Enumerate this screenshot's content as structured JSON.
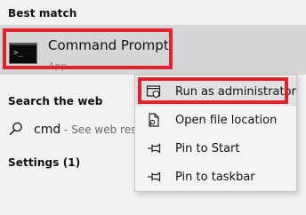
{
  "best_match": {
    "heading": "Best match",
    "app_name": "Command Prompt",
    "app_type": "App",
    "icon": "command-prompt-icon"
  },
  "search_web": {
    "heading": "Search the web",
    "query": "cmd",
    "suffix": " - See web resu",
    "icon": "search-icon"
  },
  "settings": {
    "heading": "Settings (1)"
  },
  "context_menu": {
    "items": [
      {
        "label": "Run as administrator",
        "icon": "shield-admin-icon"
      },
      {
        "label": "Open file location",
        "icon": "file-location-icon"
      },
      {
        "label": "Pin to Start",
        "icon": "pin-icon"
      },
      {
        "label": "Pin to taskbar",
        "icon": "pin-icon"
      }
    ]
  },
  "colors": {
    "highlight_border": "#e3222d",
    "selected_row": "#d6d6d6",
    "background": "#f2f2f2"
  }
}
